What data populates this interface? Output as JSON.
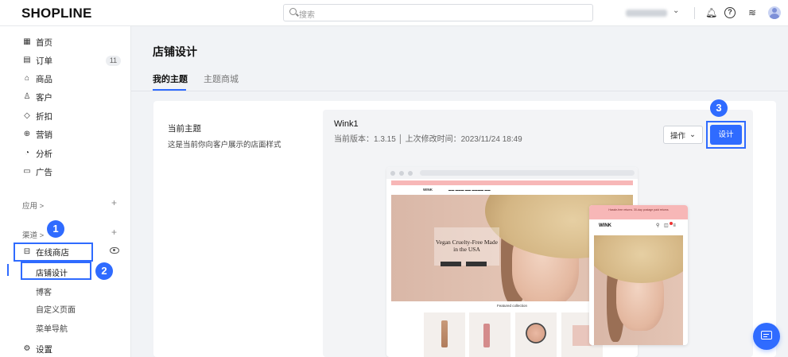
{
  "app": {
    "logo": "SHOPLINE"
  },
  "topbar": {
    "search_placeholder": "搜索"
  },
  "sidebar": {
    "items": [
      {
        "label": "首页",
        "icon": "home-icon"
      },
      {
        "label": "订单",
        "icon": "order-icon",
        "badge": "11"
      },
      {
        "label": "商品",
        "icon": "product-icon"
      },
      {
        "label": "客户",
        "icon": "customer-icon"
      },
      {
        "label": "折扣",
        "icon": "discount-icon"
      },
      {
        "label": "营销",
        "icon": "marketing-icon"
      },
      {
        "label": "分析",
        "icon": "analytics-icon"
      },
      {
        "label": "广告",
        "icon": "ads-icon"
      }
    ],
    "apps_label": "应用 >",
    "channels_label": "渠道 >",
    "online_store": "在线商店",
    "sub_items": [
      "店铺设计",
      "博客",
      "自定义页面",
      "菜单导航"
    ],
    "settings": "设置"
  },
  "main": {
    "title": "店铺设计",
    "tabs": [
      "我的主题",
      "主题商城"
    ],
    "current_theme_label": "当前主题",
    "current_theme_desc": "这是当前你向客户展示的店面样式",
    "theme": {
      "name": "Wink1",
      "meta": "当前版本：1.3.15 │ 上次修改时间：2023/11/24 18:49"
    },
    "ops_button": "操作",
    "design_button": "设计"
  },
  "preview": {
    "hero_title": "Vegan Cruelty-Free Made in the USA",
    "featured": "Featured collection",
    "brand": "WINK",
    "mobile_promo": "Hassle-free returns. 30-day postage paid returns"
  },
  "steps": [
    "1",
    "2",
    "3"
  ],
  "colors": {
    "accent": "#2f6bff",
    "promo_pink": "#f7b7b7"
  }
}
